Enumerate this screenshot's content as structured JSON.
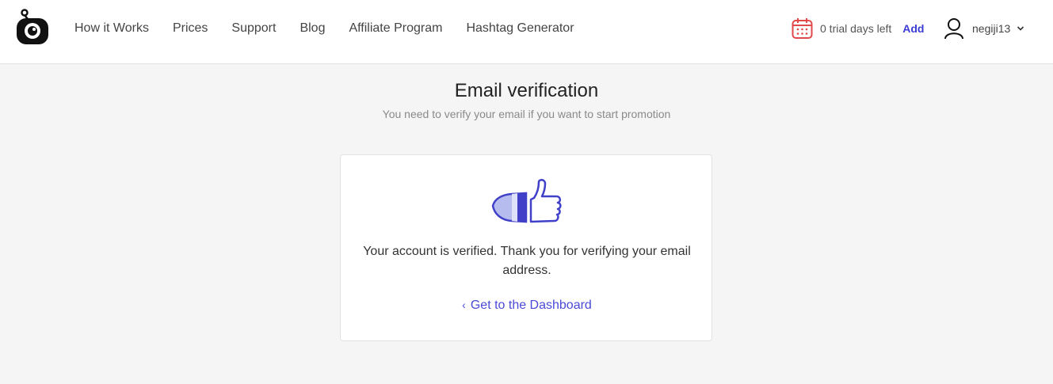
{
  "header": {
    "nav": [
      {
        "label": "How it Works"
      },
      {
        "label": "Prices"
      },
      {
        "label": "Support"
      },
      {
        "label": "Blog"
      },
      {
        "label": "Affiliate Program"
      },
      {
        "label": "Hashtag Generator"
      }
    ],
    "trial_text": "0 trial days left",
    "add_label": "Add",
    "username": "negiji13"
  },
  "main": {
    "title": "Email verification",
    "subtitle": "You need to verify your email if you want to start promotion",
    "message": "Your account is verified. Thank you for verifying your email address.",
    "dashboard_link": "Get to the Dashboard"
  },
  "colors": {
    "accent": "#4a4ad6",
    "calendar_icon": "#e04a4a"
  }
}
